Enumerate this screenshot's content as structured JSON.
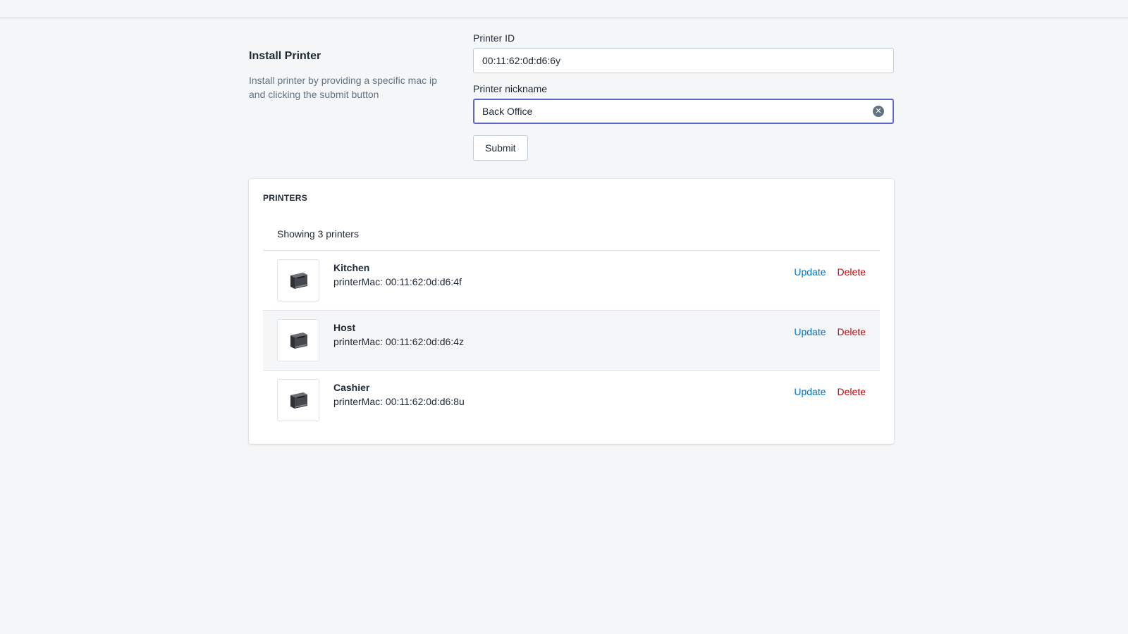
{
  "install": {
    "title": "Install Printer",
    "description": "Install printer by providing a specific mac ip and clicking the submit button"
  },
  "form": {
    "printer_id_label": "Printer ID",
    "printer_id_value": "00:11:62:0d:d6:6y",
    "nickname_label": "Printer nickname",
    "nickname_value": "Back Office",
    "submit_label": "Submit"
  },
  "printers_card": {
    "heading": "PRINTERS",
    "showing_text": "Showing 3 printers",
    "items": [
      {
        "name": "Kitchen",
        "mac": "printerMac: 00:11:62:0d:d6:4f",
        "update_label": "Update",
        "delete_label": "Delete",
        "icon": "printer-icon"
      },
      {
        "name": "Host",
        "mac": "printerMac: 00:11:62:0d:d6:4z",
        "update_label": "Update",
        "delete_label": "Delete",
        "icon": "printer-icon"
      },
      {
        "name": "Cashier",
        "mac": "printerMac: 00:11:62:0d:d6:8u",
        "update_label": "Update",
        "delete_label": "Delete",
        "icon": "printer-icon"
      }
    ]
  },
  "colors": {
    "background": "#f4f6f8",
    "focus_border": "#5c6ac4",
    "update_link": "#006fbb",
    "delete_link": "#bf0711"
  }
}
